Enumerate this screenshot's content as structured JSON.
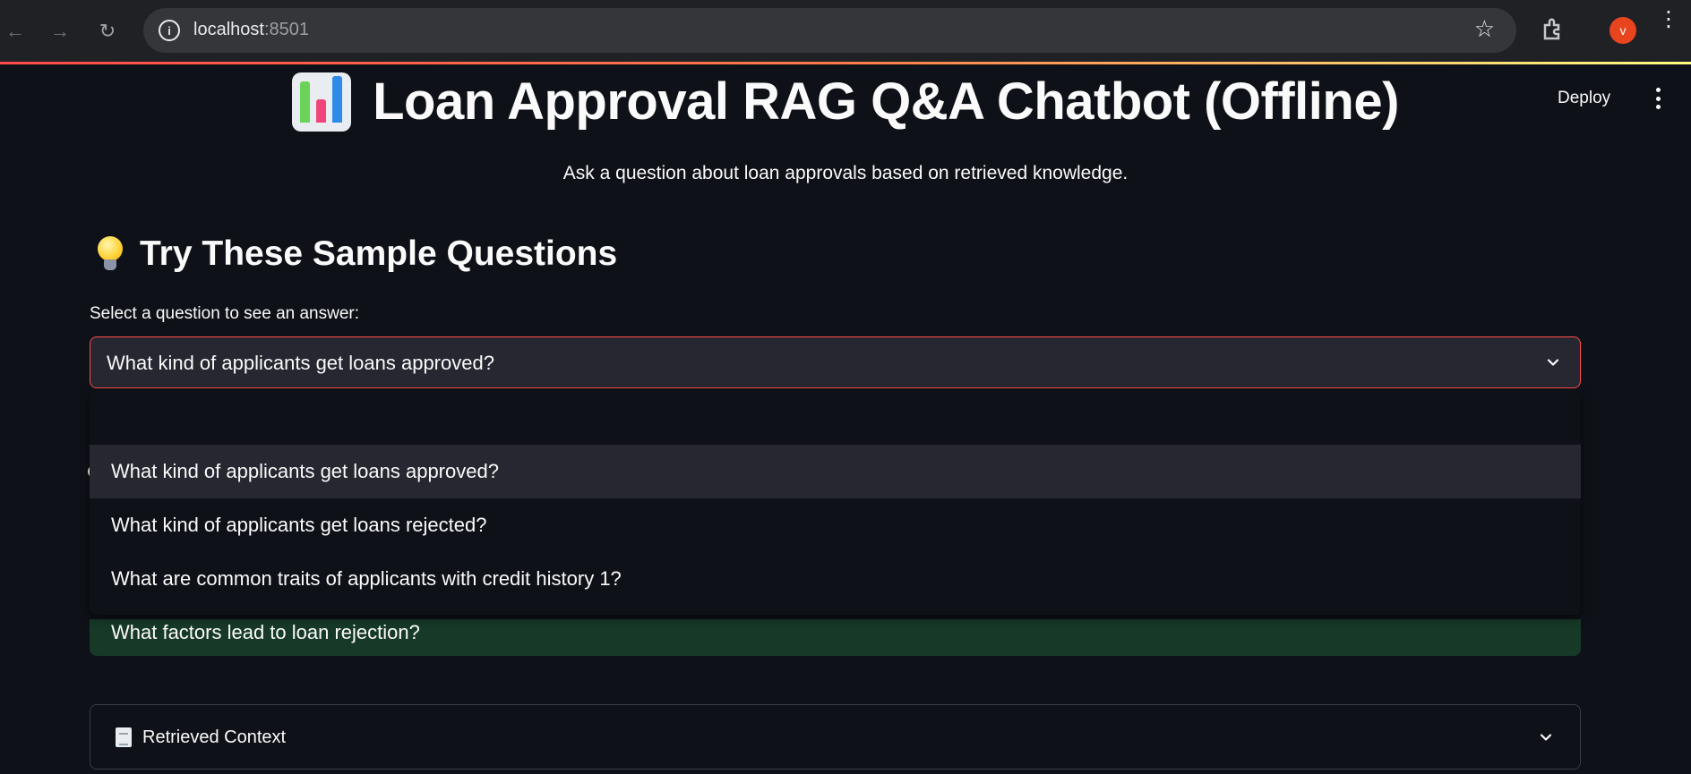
{
  "browser": {
    "back_icon": "arrow-left-icon",
    "forward_icon": "arrow-right-icon",
    "reload_icon": "reload-icon",
    "url_host": "localhost",
    "url_port": ":8501",
    "profile_initial": "v"
  },
  "header": {
    "deploy_label": "Deploy"
  },
  "main": {
    "title": "Loan Approval RAG Q&A Chatbot (Offline)",
    "subtitle": "Ask a question about loan approvals based on retrieved knowledge.",
    "section_title": "Try These Sample Questions",
    "select_label": "Select a question to see an answer:",
    "selected_question": "What kind of applicants get loans approved?",
    "options": [
      "What kind of applicants get loans approved?",
      "What kind of applicants get loans rejected?",
      "What are common traits of applicants with credit history 1?",
      "What factors lead to loan rejection?"
    ],
    "expander_label": "Retrieved Context"
  },
  "colors": {
    "background": "#0e1117",
    "accent": "#ff4b4b",
    "input_bg": "#262730",
    "success_bg": "#173928"
  }
}
